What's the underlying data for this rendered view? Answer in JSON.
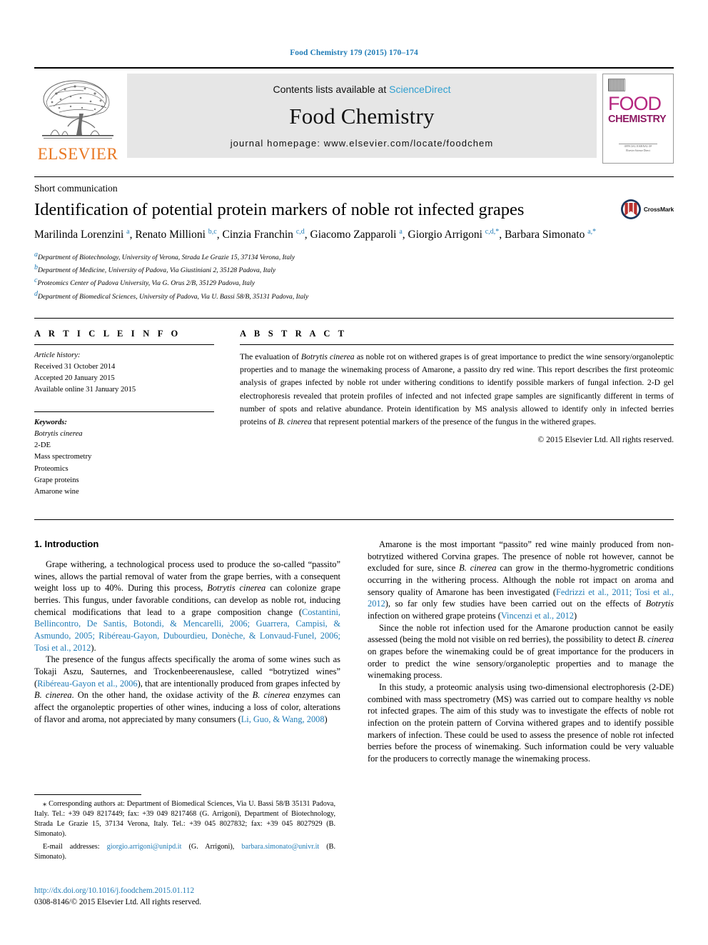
{
  "running_head": "Food Chemistry 179 (2015) 170–174",
  "masthead": {
    "contents_prefix": "Contents lists available at ",
    "sciencedirect": "ScienceDirect",
    "journal_name": "Food Chemistry",
    "homepage": "journal homepage: www.elsevier.com/locate/foodchem",
    "publisher": "ELSEVIER",
    "cover": {
      "title_line1": "FOOD",
      "title_line2": "CHEMISTRY",
      "footer_line1": "OFFICIAL JOURNAL OF",
      "footer_line2": "Elsevier Science Direct"
    },
    "accent_blue": "#2f9fd0",
    "elsevier_orange": "#E87722",
    "cover_magenta": "#b5267f"
  },
  "article": {
    "category": "Short communication",
    "title": "Identification of potential protein markers of noble rot infected grapes",
    "crossmark_label": "CrossMark",
    "authors_html": "Marilinda Lorenzini <sup>a</sup>, Renato Millioni <sup>b,c</sup>, Cinzia Franchin <sup>c,d</sup>, Giacomo Zapparoli <sup>a</sup>, Giorgio Arrigoni <sup>c,d,</sup><sup>*</sup>, Barbara Simonato <sup>a,</sup><sup>*</sup>",
    "affiliations": [
      "Department of Biotechnology, University of Verona, Strada Le Grazie 15, 37134 Verona, Italy",
      "Department of Medicine, University of Padova, Via Giustiniani 2, 35128 Padova, Italy",
      "Proteomics Center of Padova University, Via G. Orus 2/B, 35129 Padova, Italy",
      "Department of Biomedical Sciences, University of Padova, Via U. Bassi 58/B, 35131 Padova, Italy"
    ],
    "affiliation_marks": [
      "a",
      "b",
      "c",
      "d"
    ]
  },
  "info": {
    "heading": "A R T I C L E    I N F O",
    "history_label": "Article history:",
    "history": [
      "Received 31 October 2014",
      "Accepted 20 January 2015",
      "Available online 31 January 2015"
    ],
    "keywords_label": "Keywords:",
    "keywords": [
      "Botrytis cinerea",
      "2-DE",
      "Mass spectrometry",
      "Proteomics",
      "Grape proteins",
      "Amarone wine"
    ],
    "keyword_italic_index": 0
  },
  "abstract": {
    "heading": "A B S T R A C T",
    "text_html": "The evaluation of <i>Botrytis cinerea</i> as noble rot on withered grapes is of great importance to predict the wine sensory/organoleptic properties and to manage the winemaking process of Amarone, a passito dry red wine. This report describes the first proteomic analysis of grapes infected by noble rot under withering conditions to identify possible markers of fungal infection. 2-D gel electrophoresis revealed that protein profiles of infected and not infected grape samples are significantly different in terms of number of spots and relative abundance. Protein identification by MS analysis allowed to identify only in infected berries proteins of <i>B. cinerea</i> that represent potential markers of the presence of the fungus in the withered grapes.",
    "copyright": "© 2015 Elsevier Ltd. All rights reserved."
  },
  "body": {
    "section_heading": "1. Introduction",
    "left_paragraphs_html": [
      "Grape withering, a technological process used to produce the so-called “passito” wines, allows the partial removal of water from the grape berries, with a consequent weight loss up to 40%. During this process, <i>Botrytis cinerea</i> can colonize grape berries. This fungus, under favorable conditions, can develop as noble rot, inducing chemical modifications that lead to a grape composition change (<span class=\"cite\">Costantini, Bellincontro, De Santis, Botondi, &amp; Mencarelli, 2006; Guarrera, Campisi, &amp; Asmundo, 2005; Ribéreau-Gayon, Dubourdieu, Donèche, &amp; Lonvaud-Funel, 2006; Tosi et al., 2012</span>).",
      "The presence of the fungus affects specifically the aroma of some wines such as Tokaji Aszu, Sauternes, and Trockenbeerenauslese, called “botrytized wines” (<span class=\"cite\">Ribéreau-Gayon et al., 2006</span>), that are intentionally produced from grapes infected by <i>B. cinerea</i>. On the other hand, the oxidase activity of the <i>B. cinerea</i> enzymes can affect the organoleptic properties of other wines, inducing a loss of color, alterations of flavor and aroma, not appreciated by many consumers (<span class=\"cite\">Li, Guo, &amp; Wang, 2008</span>)"
    ],
    "right_paragraphs_html": [
      "Amarone is the most important “passito” red wine mainly produced from non-botrytized withered Corvina grapes. The presence of noble rot however, cannot be excluded for sure, since <i>B. cinerea</i> can grow in the thermo-hygrometric conditions occurring in the withering process. Although the noble rot impact on aroma and sensory quality of Amarone has been investigated (<span class=\"cite\">Fedrizzi et al., 2011; Tosi et al., 2012</span>), so far only few studies have been carried out on the effects of <i>Botrytis</i> infection on withered grape proteins (<span class=\"cite\">Vincenzi et al., 2012</span>)",
      "Since the noble rot infection used for the Amarone production cannot be easily assessed (being the mold not visible on red berries), the possibility to detect <i>B. cinerea</i> on grapes before the winemaking could be of great importance for the producers in order to predict the wine sensory/organoleptic properties and to manage the winemaking process.",
      "In this study, a proteomic analysis using two-dimensional electrophoresis (2-DE) combined with mass spectrometry (MS) was carried out to compare healthy <i>vs</i> noble rot infected grapes. The aim of this study was to investigate the effects of noble rot infection on the protein pattern of Corvina withered grapes and to identify possible markers of infection. These could be used to assess the presence of noble rot infected berries before the process of winemaking. Such information could be very valuable for the producers to correctly manage the winemaking process."
    ]
  },
  "footnotes": {
    "corresponding_html": "<span class=\"em\">⁎</span> Corresponding authors at: Department of Biomedical Sciences, Via U. Bassi 58/B 35131 Padova, Italy. Tel.: +39 049 8217449; fax: +39 049 8217468 (G. Arrigoni), Department of Biotechnology, Strada Le Grazie 15, 37134 Verona, Italy. Tel.: +39 045 8027832; fax: +39 045 8027929 (B. Simonato).",
    "email_html": "<span class=\"em\">E-mail addresses:</span> <span class=\"link\">giorgio.arrigoni@unipd.it</span> (G. Arrigoni), <span class=\"link\">barbara.simonato@univr.it</span> (B. Simonato).",
    "doi": "http://dx.doi.org/10.1016/j.foodchem.2015.01.112",
    "issn_line": "0308-8146/© 2015 Elsevier Ltd. All rights reserved."
  }
}
